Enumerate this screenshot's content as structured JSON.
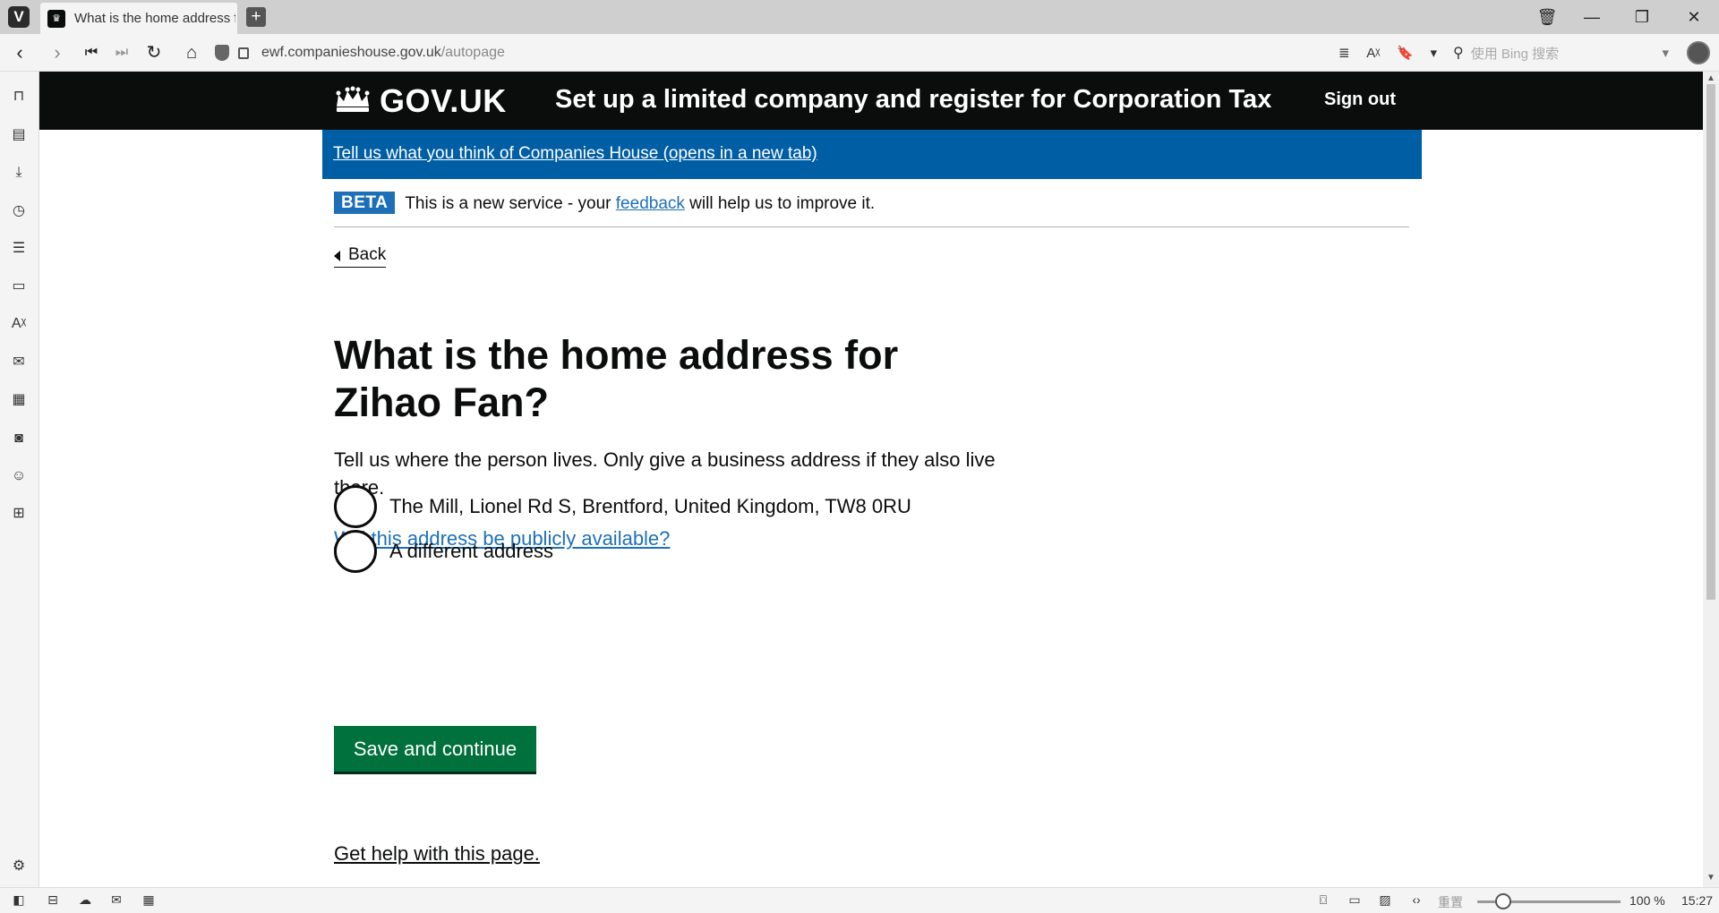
{
  "browser": {
    "tab_title": "What is the home address f",
    "new_tab_icon": "plus-icon",
    "url_domain": "ewf.companieshouse.gov.uk",
    "url_path": "/autopage",
    "search_placeholder": "使用 Bing 搜索",
    "zoom_reset_label": "重置",
    "zoom_level": "100 %",
    "clock": "15:27"
  },
  "header": {
    "logo_text": "GOV.UK",
    "service_name": "Set up a limited company and register for Corporation Tax",
    "sign_out": "Sign out"
  },
  "feedback_banner": {
    "link_text": "Tell us what you think of Companies House (opens in a new tab)"
  },
  "phase_banner": {
    "tag": "BETA",
    "text_before": "This is a new service - your ",
    "link_text": "feedback",
    "text_after": " will help us to improve it."
  },
  "main": {
    "back_link": "Back",
    "heading": "What is the home address for Zihao Fan?",
    "hint": "Tell us where the person lives. Only give a business address if they also live there.",
    "public_link": "Will this address be publicly available?",
    "options": [
      {
        "label": "The Mill, Lionel Rd S, Brentford, United Kingdom, TW8 0RU"
      },
      {
        "label": "A different address"
      }
    ],
    "save_button": "Save and continue",
    "help_link": "Get help with this page."
  }
}
